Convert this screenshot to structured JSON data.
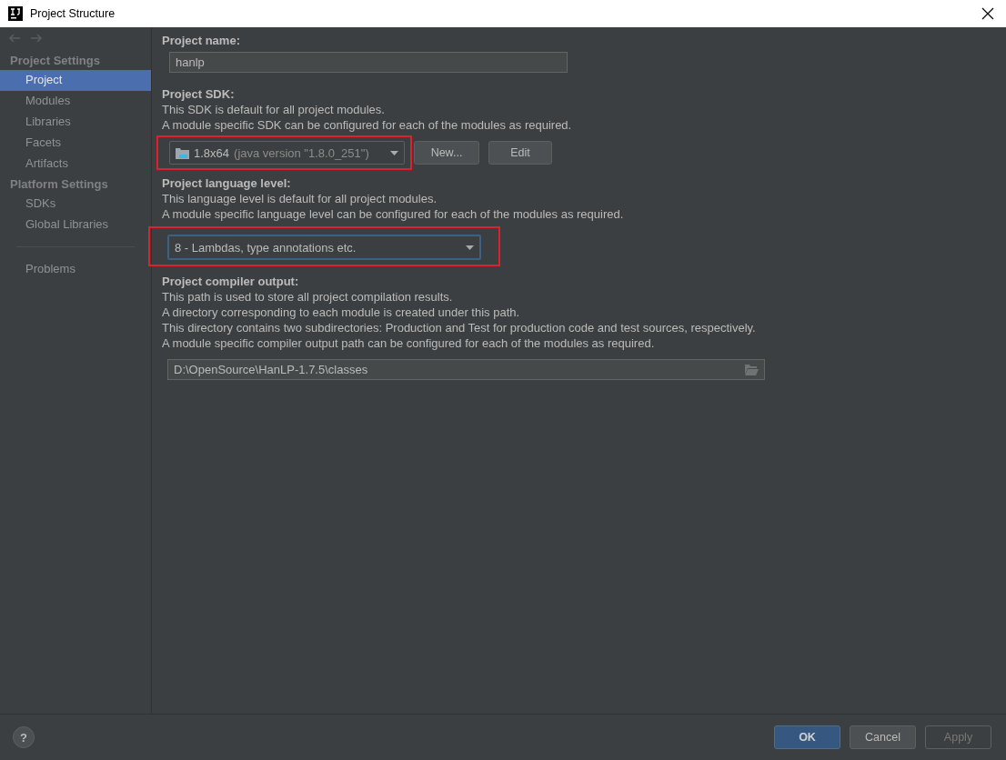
{
  "window": {
    "title": "Project Structure"
  },
  "sidebar": {
    "sections": [
      {
        "title": "Project Settings",
        "items": [
          {
            "label": "Project",
            "selected": true
          },
          {
            "label": "Modules",
            "selected": false
          },
          {
            "label": "Libraries",
            "selected": false
          },
          {
            "label": "Facets",
            "selected": false
          },
          {
            "label": "Artifacts",
            "selected": false
          }
        ]
      },
      {
        "title": "Platform Settings",
        "items": [
          {
            "label": "SDKs",
            "selected": false
          },
          {
            "label": "Global Libraries",
            "selected": false
          }
        ]
      },
      {
        "items": [
          {
            "label": "Problems",
            "selected": false
          }
        ]
      }
    ]
  },
  "project_name": {
    "label": "Project name:",
    "value": "hanlp"
  },
  "project_sdk": {
    "label": "Project SDK:",
    "description": [
      "This SDK is default for all project modules.",
      "A module specific SDK can be configured for each of the modules as required."
    ],
    "value": "1.8x64",
    "detail": "(java version \"1.8.0_251\")",
    "buttons": [
      {
        "label": "New...",
        "disabled": false
      },
      {
        "label": "Edit",
        "disabled": false
      }
    ],
    "highlighted": true
  },
  "language_level": {
    "label": "Project language level:",
    "description": [
      "This language level is default for all project modules.",
      "A module specific language level can be configured for each of the modules as required."
    ],
    "value": "8 - Lambdas, type annotations etc.",
    "highlighted": true,
    "focused": true
  },
  "compiler_output": {
    "label": "Project compiler output:",
    "description": [
      "This path is used to store all project compilation results.",
      "A directory corresponding to each module is created under this path.",
      "This directory contains two subdirectories: Production and Test for production code and test sources, respectively.",
      "A module specific compiler output path can be configured for each of the modules as required."
    ],
    "value": "D:\\OpenSource\\HanLP-1.7.5\\classes"
  },
  "footer": {
    "help": "?",
    "buttons": [
      {
        "label": "OK",
        "kind": "primary",
        "disabled": false
      },
      {
        "label": "Cancel",
        "kind": "normal",
        "disabled": false
      },
      {
        "label": "Apply",
        "kind": "normal",
        "disabled": true
      }
    ]
  }
}
